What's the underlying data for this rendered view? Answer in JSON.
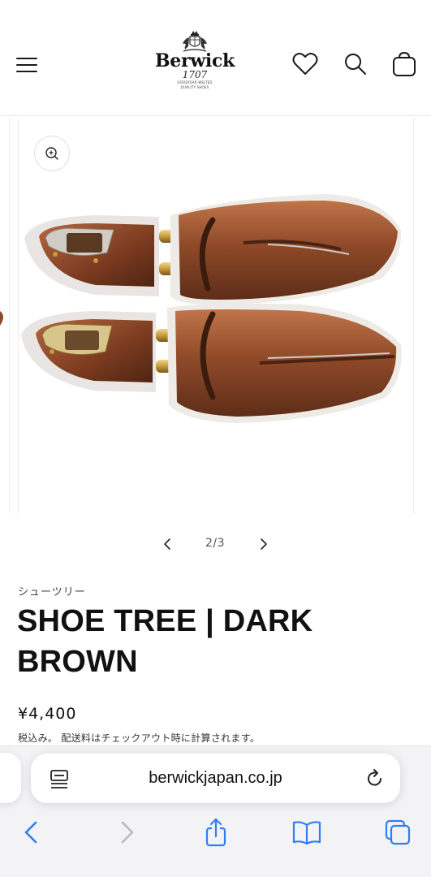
{
  "header": {
    "brand": {
      "name": "Berwick",
      "year": "1707",
      "tagline_line1": "GOODYEAR WELTED",
      "tagline_line2": "QUALITY SHOES"
    },
    "icons": {
      "menu": "hamburger-menu-icon",
      "wishlist": "heart-icon",
      "search": "search-icon",
      "cart": "cart-bag-icon"
    }
  },
  "product": {
    "image_alt": "shoe-tree-dark-brown-photo",
    "zoom_icon": "zoom-in-icon",
    "slider": {
      "counter": "2/3",
      "prev_icon": "chevron-left-icon",
      "next_icon": "chevron-right-icon"
    },
    "vendor": "シューツリー",
    "title": "SHOE TREE | DARK BROWN",
    "price": "¥4,400",
    "tax_note": "税込み。 配送料はチェックアウト時に計算されます。"
  },
  "browser": {
    "url": "berwickjapan.co.jp",
    "icons": {
      "reader": "reader-view-icon",
      "reload": "reload-icon",
      "back": "chevron-left-icon",
      "forward": "chevron-right-icon",
      "share": "share-icon",
      "bookmarks": "book-icon",
      "tabs": "tabs-icon"
    },
    "colors": {
      "accent": "#2f7ef6",
      "disabled": "#b9b9be"
    }
  }
}
